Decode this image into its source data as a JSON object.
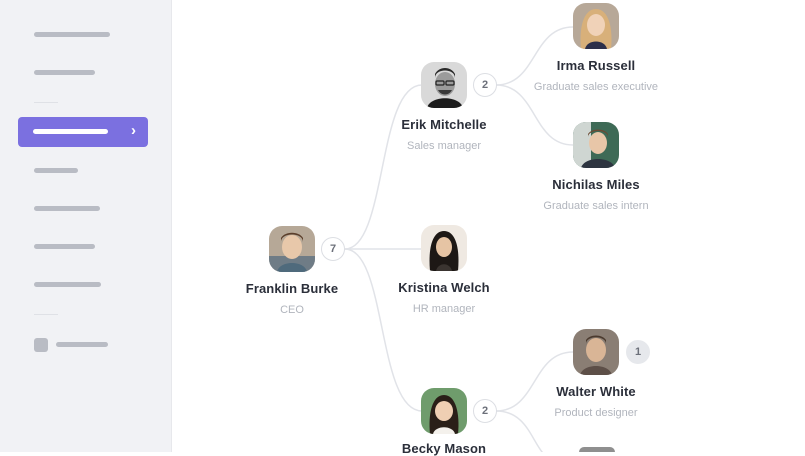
{
  "nodes": [
    {
      "id": "franklin",
      "name": "Franklin Burke",
      "role": "CEO",
      "count": "7"
    },
    {
      "id": "erik",
      "name": "Erik Mitchelle",
      "role": "Sales manager",
      "count": "2"
    },
    {
      "id": "irma",
      "name": "Irma Russell",
      "role": "Graduate sales executive"
    },
    {
      "id": "nichilas",
      "name": "Nichilas Miles",
      "role": "Graduate sales intern"
    },
    {
      "id": "kristina",
      "name": "Kristina Welch",
      "role": "HR manager"
    },
    {
      "id": "becky",
      "name": "Becky Mason",
      "role": "",
      "count": "2"
    },
    {
      "id": "walter",
      "name": "Walter White",
      "role": "Product designer",
      "count": "1"
    }
  ],
  "colors": {
    "accent": "#7b70e0",
    "sidebar_bg": "#f1f2f5",
    "connector": "#e1e3e8"
  }
}
